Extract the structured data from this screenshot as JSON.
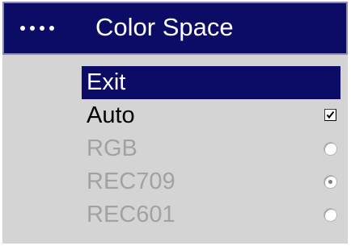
{
  "menu": {
    "title": "Color Space",
    "title_icon": "four-dots-icon",
    "colors": {
      "title_bg": "#0c0c66",
      "panel_bg": "#d4d4d4",
      "disabled_text": "#a2a2a2"
    },
    "items": [
      {
        "label": "Exit",
        "state": "selected",
        "control": "none"
      },
      {
        "label": "Auto",
        "state": "enabled",
        "control": "checkbox",
        "checked": true
      },
      {
        "label": "RGB",
        "state": "disabled",
        "control": "radio",
        "selected": false
      },
      {
        "label": "REC709",
        "state": "disabled",
        "control": "radio",
        "selected": true
      },
      {
        "label": "REC601",
        "state": "disabled",
        "control": "radio",
        "selected": false
      }
    ]
  }
}
